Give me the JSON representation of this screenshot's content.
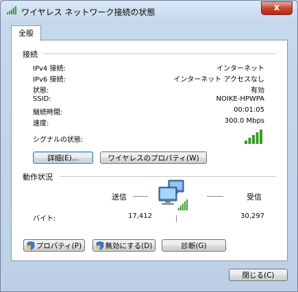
{
  "window": {
    "title": "ワイヤレス ネットワーク接続の状態",
    "close_symbol": "x"
  },
  "tabs": [
    {
      "label": "全般"
    }
  ],
  "connection": {
    "header": "接続",
    "rows": [
      {
        "label": "IPv4 接続:",
        "value": "インターネット"
      },
      {
        "label": "IPv6 接続:",
        "value": "インターネット アクセスなし"
      },
      {
        "label": "状態:",
        "value": "有効"
      },
      {
        "label": "SSID:",
        "value": "NOIKE-HPWPA"
      },
      {
        "label": "継続時間:",
        "value": "00:01:05"
      },
      {
        "label": "速度:",
        "value": "300.0 Mbps"
      }
    ],
    "signal_label": "シグナルの状態:",
    "signal_bars_lit": 5,
    "signal_bars_total": 5,
    "details_button": "詳細(E)...",
    "wireless_props_button": "ワイヤレスのプロパティ(W)"
  },
  "activity": {
    "header": "動作状況",
    "sent_label": "送信",
    "received_label": "受信",
    "bytes_label": "バイト:",
    "bytes_sent": "17,412",
    "bytes_received": "30,297"
  },
  "actions": {
    "properties_button": "プロパティ(P)",
    "disable_button": "無効にする(D)",
    "diagnose_button": "診断(G)"
  },
  "footer": {
    "close_button": "閉じる(C)"
  },
  "colors": {
    "signal_green": "#3a9a2c",
    "accent": "#3c7fb1"
  }
}
